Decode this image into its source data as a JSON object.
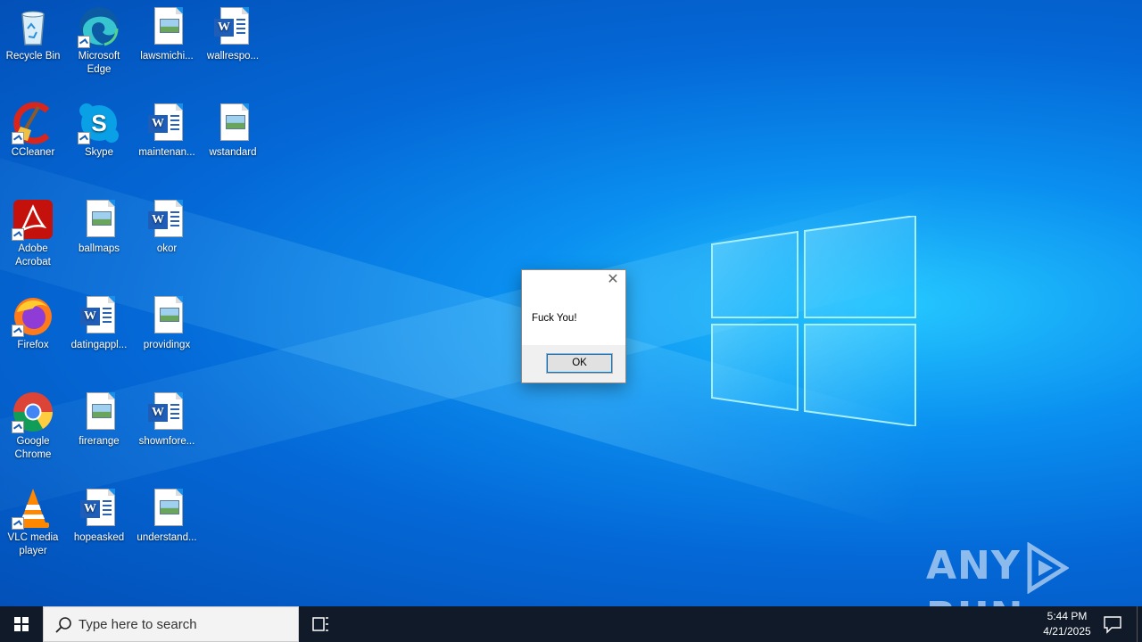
{
  "desktop": {
    "icons": [
      {
        "label": "Recycle Bin"
      },
      {
        "label": "Microsoft Edge"
      },
      {
        "label": "lawsmichi..."
      },
      {
        "label": "wallrespo..."
      },
      {
        "label": "CCleaner"
      },
      {
        "label": "Skype"
      },
      {
        "label": "maintenan..."
      },
      {
        "label": "wstandard"
      },
      {
        "label": "Adobe Acrobat"
      },
      {
        "label": "ballmaps"
      },
      {
        "label": "okor"
      },
      {
        "label": "Firefox"
      },
      {
        "label": "datingappl..."
      },
      {
        "label": "providingx"
      },
      {
        "label": "Google Chrome"
      },
      {
        "label": "firerange"
      },
      {
        "label": "shownfore..."
      },
      {
        "label": "VLC media player"
      },
      {
        "label": "hopeasked"
      },
      {
        "label": "understand..."
      }
    ]
  },
  "dialog": {
    "message": "Fuck You!",
    "ok_label": "OK",
    "close_glyph": "✕"
  },
  "watermark": {
    "left": "ANY",
    "right": "RUN"
  },
  "taskbar": {
    "search_placeholder": "Type here to search",
    "time": "5:44 PM",
    "date": "4/21/2025"
  },
  "colors": {
    "desktop_accent": "#0a8ff0",
    "taskbar_bg": "#101a29",
    "word_blue": "#1e5eb8"
  }
}
